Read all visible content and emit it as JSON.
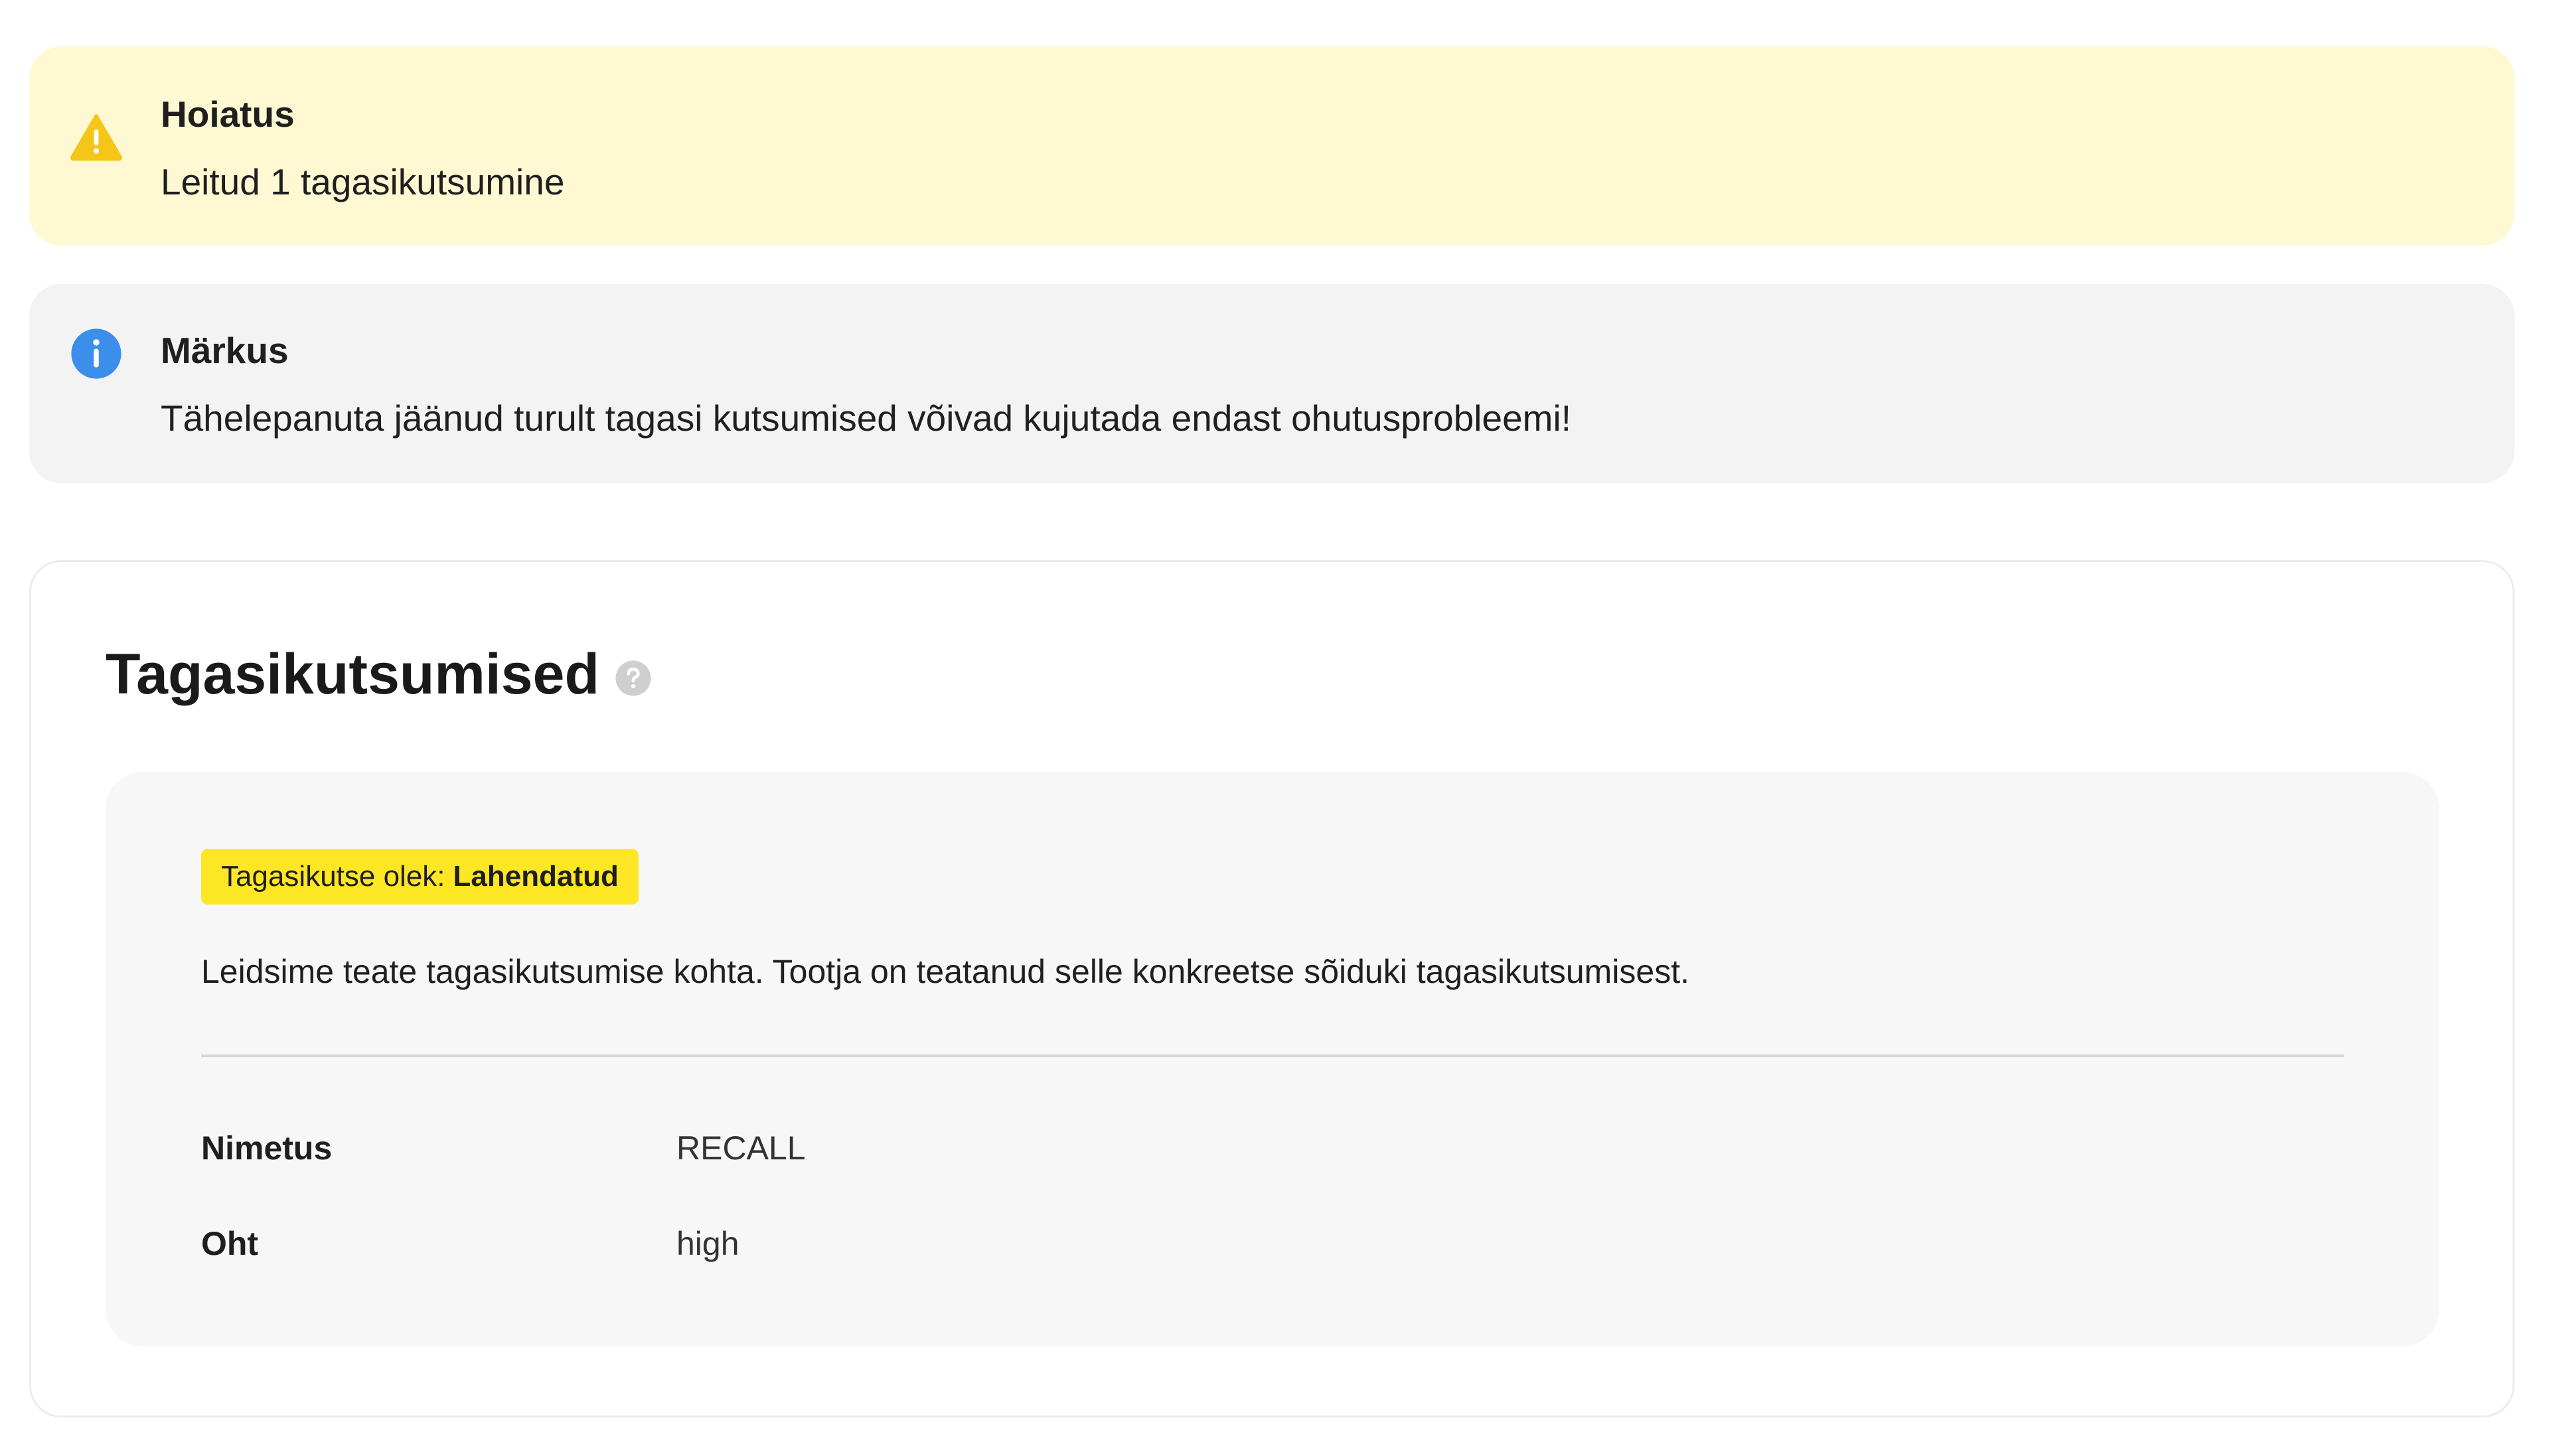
{
  "warning_alert": {
    "title": "Hoiatus",
    "text": "Leitud 1 tagasikutsumine",
    "icon": "warning-icon",
    "color": "#f5c518",
    "background": "#fef9d2"
  },
  "info_alert": {
    "title": "Märkus",
    "text": "Tähelepanuta jäänud turult tagasi kutsumised võivad kujutada endast ohutusprobleemi!",
    "icon": "info-icon",
    "color": "#3b8eea",
    "background": "#f3f3f3"
  },
  "recalls_section": {
    "title": "Tagasikutsumised",
    "help_icon": "help-icon",
    "status_badge": {
      "label": "Tagasikutse olek:",
      "value": "Lahendatud",
      "color": "#fde725"
    },
    "description": "Leidsime teate tagasikutsumise kohta. Tootja on teatanud selle konkreetse sõiduki tagasikutsumisest.",
    "details": [
      {
        "label": "Nimetus",
        "value": "RECALL"
      },
      {
        "label": "Oht",
        "value": "high"
      }
    ]
  }
}
